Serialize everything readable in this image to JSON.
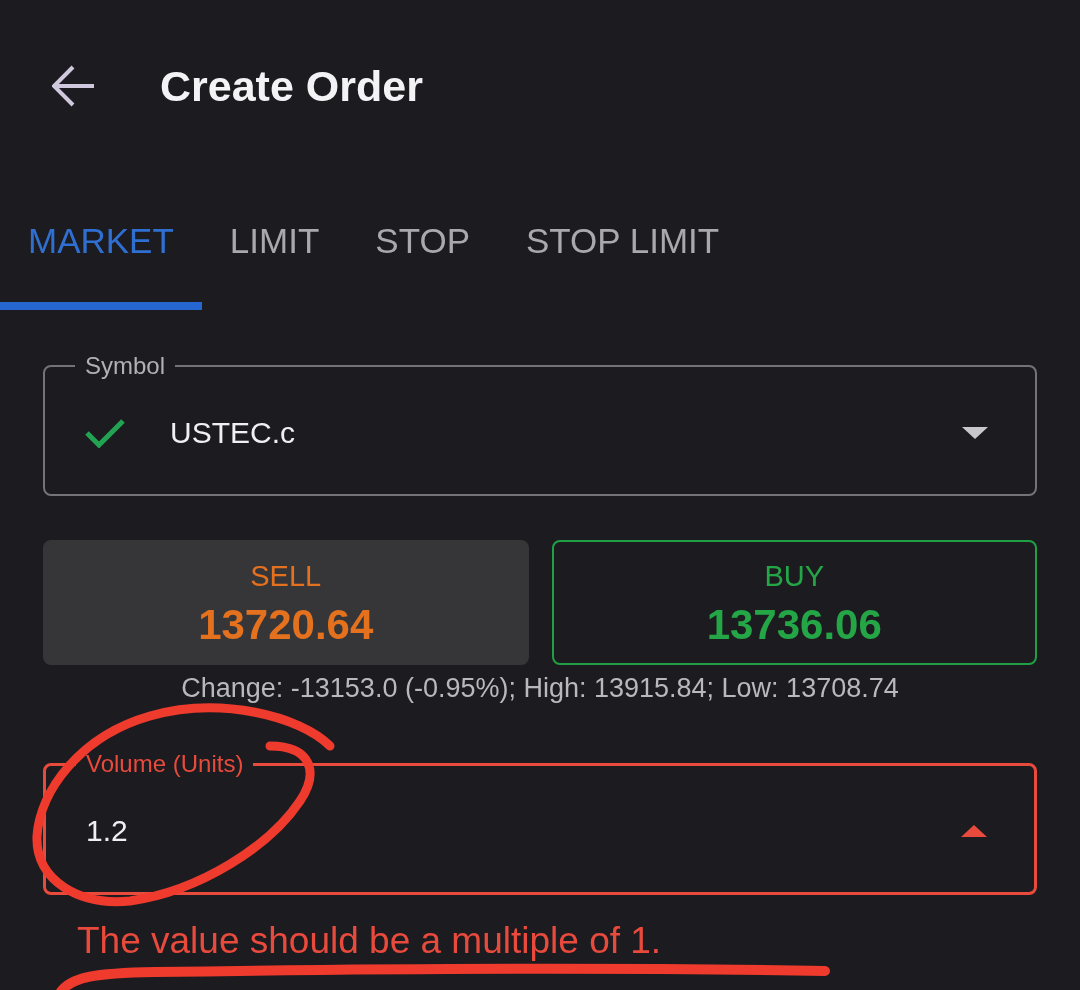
{
  "header": {
    "title": "Create Order"
  },
  "tabs": [
    {
      "label": "MARKET",
      "selected": true
    },
    {
      "label": "LIMIT",
      "selected": false
    },
    {
      "label": "STOP",
      "selected": false
    },
    {
      "label": "STOP LIMIT",
      "selected": false
    }
  ],
  "symbol_field": {
    "label": "Symbol",
    "value": "USTEC.c",
    "valid": true,
    "error": false,
    "expanded": false
  },
  "quotes": [
    {
      "kind": "sell",
      "label": "SELL",
      "price": "13720.64"
    },
    {
      "kind": "buy",
      "label": "BUY",
      "price": "13736.06"
    }
  ],
  "stats": "Change: -13153.0 (-0.95%); High: 13915.84; Low: 13708.74",
  "volume_field": {
    "label": "Volume (Units)",
    "value": "1.2",
    "error": true,
    "expanded": true,
    "circled": true
  },
  "error_message": {
    "text": "The value should be a multiple of 1.",
    "underlined": true
  }
}
